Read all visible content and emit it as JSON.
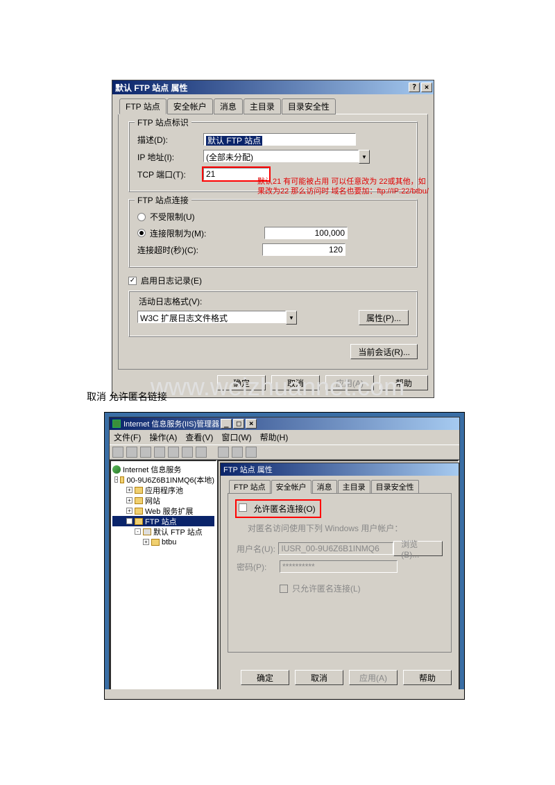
{
  "dialog1": {
    "title": "默认 FTP 站点 属性",
    "tabs": [
      "FTP 站点",
      "安全帐户",
      "消息",
      "主目录",
      "目录安全性"
    ],
    "group_id": {
      "legend": "FTP 站点标识",
      "desc_label": "描述(D):",
      "desc_value": "默认 FTP 站点",
      "ip_label": "IP 地址(I):",
      "ip_value": "(全部未分配)",
      "port_label": "TCP 端口(T):",
      "port_value": "21"
    },
    "annotation": "默认21 有可能被占用 可以任意改为 22或其他，如果改为22 那么访问时 域名也要加：ftp://IP:22/btbu/",
    "group_conn": {
      "legend": "FTP 站点连接",
      "opt_unlimited": "不受限制(U)",
      "opt_limited": "连接限制为(M):",
      "limit_value": "100,000",
      "timeout_label": "连接超时(秒)(C):",
      "timeout_value": "120"
    },
    "log": {
      "enable": "启用日志记录(E)",
      "format_label": "活动日志格式(V):",
      "format_value": "W3C 扩展日志文件格式",
      "props_btn": "属性(P)..."
    },
    "session_btn": "当前会话(R)...",
    "buttons": {
      "ok": "确定",
      "cancel": "取消",
      "apply": "应用(A)",
      "help": "帮助"
    }
  },
  "watermark": "www.weizhuannet.com",
  "caption_between": "取消 允许匿名链接",
  "iis": {
    "title": "Internet 信息服务(IIS)管理器",
    "menu": [
      "文件(F)",
      "操作(A)",
      "查看(V)",
      "窗口(W)",
      "帮助(H)"
    ],
    "tree": {
      "root": "Internet 信息服务",
      "server": "00-9U6Z6B1INMQ6(本地)",
      "nodes": [
        "应用程序池",
        "网站",
        "Web 服务扩展"
      ],
      "ftp": "FTP 站点",
      "ftp_default": "默认 FTP 站点",
      "ftp_sub": "btbu"
    }
  },
  "dialog2": {
    "title": "FTP 站点 属性",
    "tabs": [
      "FTP 站点",
      "安全帐户",
      "消息",
      "主目录",
      "目录安全性"
    ],
    "allow_anon": "允许匿名连接(O)",
    "anon_desc": "对匿名访问使用下列 Windows 用户帐户：",
    "user_label": "用户名(U):",
    "user_value": "IUSR_00-9U6Z6B1INMQ6",
    "browse_btn": "浏览(B)...",
    "pwd_label": "密码(P):",
    "pwd_value": "**********",
    "only_anon": "只允许匿名连接(L)",
    "buttons": {
      "ok": "确定",
      "cancel": "取消",
      "apply": "应用(A)",
      "help": "帮助"
    }
  }
}
